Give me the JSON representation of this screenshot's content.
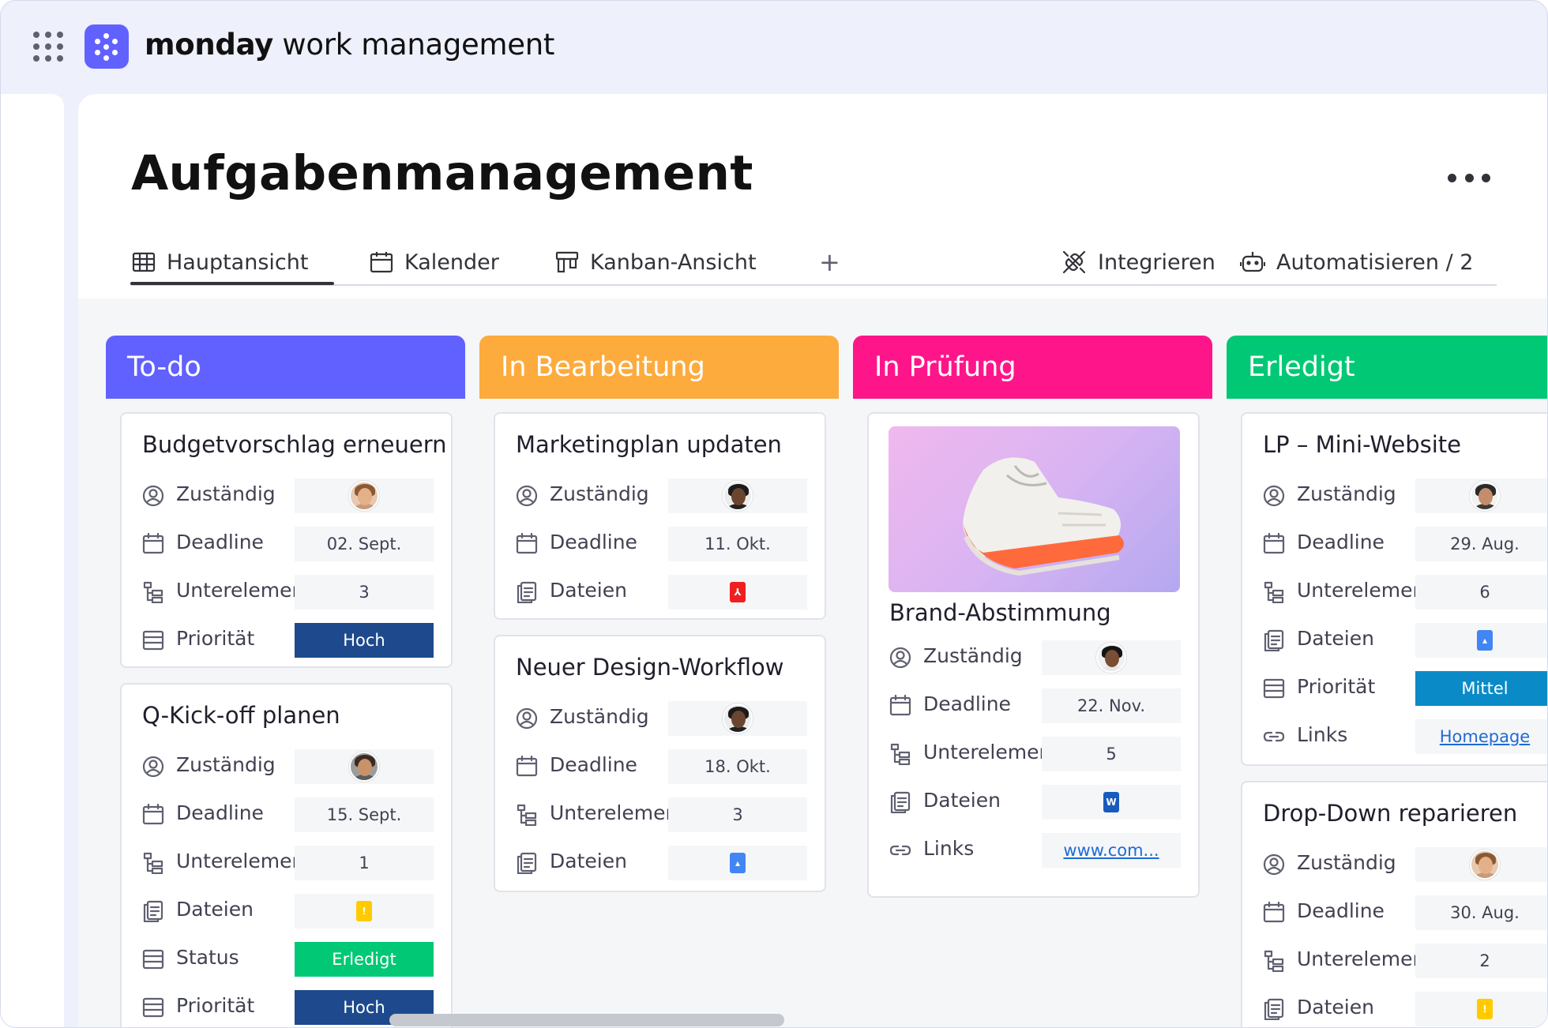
{
  "app": {
    "brand_bold": "monday",
    "brand_rest": " work management"
  },
  "board": {
    "title": "Aufgabenmanagement"
  },
  "tabs": [
    {
      "label": "Hauptansicht",
      "icon": "table-icon"
    },
    {
      "label": "Kalender",
      "icon": "calendar-icon"
    },
    {
      "label": "Kanban-Ansicht",
      "icon": "kanban-icon"
    }
  ],
  "tab_add": "+",
  "actions": {
    "integrate": "Integrieren",
    "automate": "Automatisieren / 2"
  },
  "colors": {
    "todo": "#6161ff",
    "in_progress": "#fdab3d",
    "review": "#ff158a",
    "done": "#00c875",
    "priority_high": "#1e4a8d",
    "priority_medium": "#0a8bc8",
    "status_done": "#00c875"
  },
  "columns": [
    {
      "title": "To-do",
      "color": "#6161ff",
      "cards": [
        {
          "title": "Budgetvorschlag erneuern",
          "fields": [
            {
              "icon": "person-icon",
              "label": "Zuständig",
              "type": "avatar",
              "avatar": "woman-curly"
            },
            {
              "icon": "calendar-icon",
              "label": "Deadline",
              "type": "text",
              "value": "02. Sept."
            },
            {
              "icon": "subitems-icon",
              "label": "Unterelemente",
              "type": "text",
              "value": "3"
            },
            {
              "icon": "priority-icon",
              "label": "Priorität",
              "type": "badge",
              "value": "Hoch",
              "color": "#1e4a8d"
            }
          ]
        },
        {
          "title": "Q-Kick-off planen",
          "fields": [
            {
              "icon": "person-icon",
              "label": "Zuständig",
              "type": "avatar",
              "avatar": "woman-dark"
            },
            {
              "icon": "calendar-icon",
              "label": "Deadline",
              "type": "text",
              "value": "15. Sept."
            },
            {
              "icon": "subitems-icon",
              "label": "Unterelemente",
              "type": "text",
              "value": "1"
            },
            {
              "icon": "files-icon",
              "label": "Dateien",
              "type": "file",
              "file": "yellow-file"
            },
            {
              "icon": "status-icon",
              "label": "Status",
              "type": "badge",
              "value": "Erledigt",
              "color": "#00c875"
            },
            {
              "icon": "priority-icon",
              "label": "Priorität",
              "type": "badge",
              "value": "Hoch",
              "color": "#1e4a8d"
            }
          ]
        }
      ]
    },
    {
      "title": "In Bearbeitung",
      "color": "#fdab3d",
      "cards": [
        {
          "title": "Marketingplan updaten",
          "fields": [
            {
              "icon": "person-icon",
              "label": "Zuständig",
              "type": "avatar",
              "avatar": "man-dark"
            },
            {
              "icon": "calendar-icon",
              "label": "Deadline",
              "type": "text",
              "value": "11. Okt."
            },
            {
              "icon": "files-icon",
              "label": "Dateien",
              "type": "file",
              "file": "pdf-file"
            }
          ]
        },
        {
          "title": "Neuer Design-Workflow",
          "fields": [
            {
              "icon": "person-icon",
              "label": "Zuständig",
              "type": "avatar",
              "avatar": "man-dark"
            },
            {
              "icon": "calendar-icon",
              "label": "Deadline",
              "type": "text",
              "value": "18. Okt."
            },
            {
              "icon": "subitems-icon",
              "label": "Unterelemente",
              "type": "text",
              "value": "3"
            },
            {
              "icon": "files-icon",
              "label": "Dateien",
              "type": "file",
              "file": "doc-file"
            }
          ]
        }
      ]
    },
    {
      "title": "In Prüfung",
      "color": "#ff158a",
      "cards": [
        {
          "title": "Brand-Abstimmung",
          "image": "sneaker-photo",
          "fields": [
            {
              "icon": "person-icon",
              "label": "Zuständig",
              "type": "avatar",
              "avatar": "woman-black"
            },
            {
              "icon": "calendar-icon",
              "label": "Deadline",
              "type": "text",
              "value": "22. Nov."
            },
            {
              "icon": "subitems-icon",
              "label": "Unterelemente",
              "type": "text",
              "value": "5"
            },
            {
              "icon": "files-icon",
              "label": "Dateien",
              "type": "file",
              "file": "word-file"
            },
            {
              "icon": "link-icon",
              "label": "Links",
              "type": "link",
              "value": "www.com..."
            }
          ]
        }
      ]
    },
    {
      "title": "Erledigt",
      "color": "#00c875",
      "cards": [
        {
          "title": "LP – Mini-Website",
          "fields": [
            {
              "icon": "person-icon",
              "label": "Zuständig",
              "type": "avatar",
              "avatar": "man-beard"
            },
            {
              "icon": "calendar-icon",
              "label": "Deadline",
              "type": "text",
              "value": "29. Aug."
            },
            {
              "icon": "subitems-icon",
              "label": "Unterelemente",
              "type": "text",
              "value": "6"
            },
            {
              "icon": "files-icon",
              "label": "Dateien",
              "type": "file",
              "file": "doc-file"
            },
            {
              "icon": "priority-icon",
              "label": "Priorität",
              "type": "badge",
              "value": "Mittel",
              "color": "#0a8bc8"
            },
            {
              "icon": "link-icon",
              "label": "Links",
              "type": "link",
              "value": "Homepage"
            }
          ]
        },
        {
          "title": "Drop-Down reparieren",
          "fields": [
            {
              "icon": "person-icon",
              "label": "Zuständig",
              "type": "avatar",
              "avatar": "woman-curly"
            },
            {
              "icon": "calendar-icon",
              "label": "Deadline",
              "type": "text",
              "value": "30. Aug."
            },
            {
              "icon": "subitems-icon",
              "label": "Unterelemente",
              "type": "text",
              "value": "2"
            },
            {
              "icon": "files-icon",
              "label": "Dateien",
              "type": "file",
              "file": "yellow-file"
            }
          ]
        }
      ]
    }
  ]
}
